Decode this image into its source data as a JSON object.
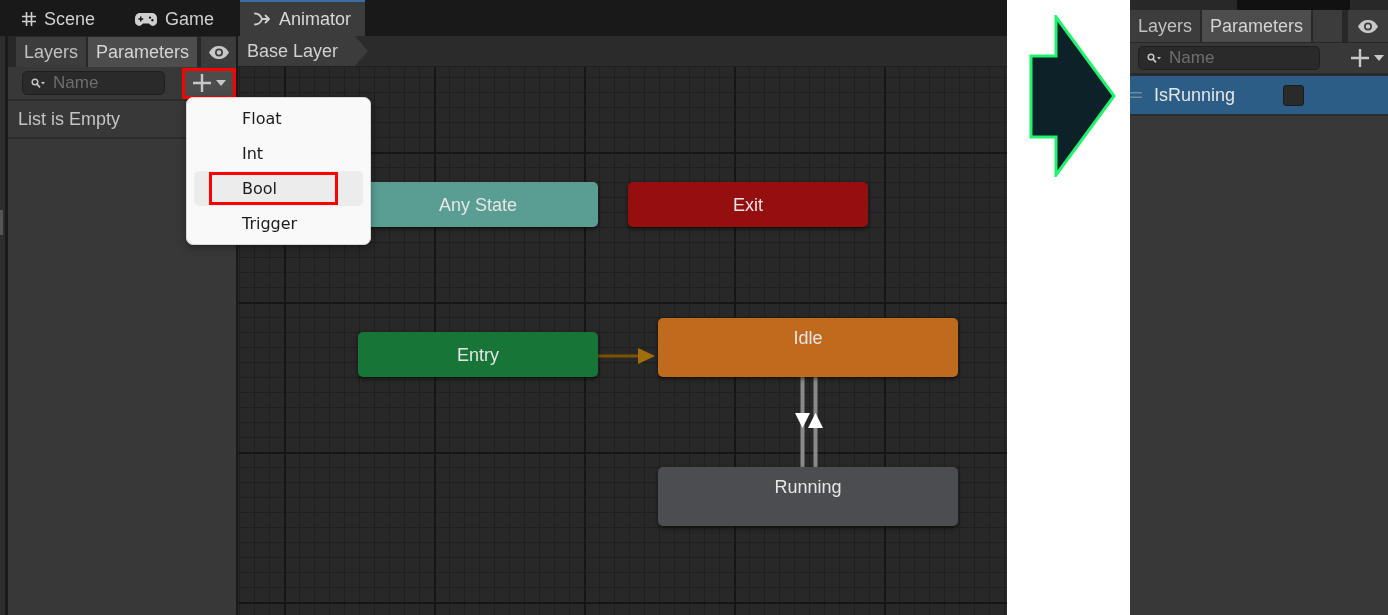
{
  "animator_window": {
    "editor_tabs": [
      {
        "label": "Scene",
        "kind": "scene",
        "selected": false
      },
      {
        "label": "Game",
        "kind": "game",
        "selected": false
      },
      {
        "label": "Animator",
        "kind": "animator",
        "selected": true
      }
    ],
    "panel_tabs": [
      {
        "label": "Layers",
        "selected": false
      },
      {
        "label": "Parameters",
        "selected": true
      }
    ],
    "search": {
      "placeholder": "Name"
    },
    "add_button": {
      "highlighted": true
    },
    "empty_list_text": "List is Empty",
    "breadcrumb": "Base Layer",
    "graph": {
      "states": [
        {
          "label": "Any State",
          "kind": "special",
          "color": "#5a9e93"
        },
        {
          "label": "Exit",
          "kind": "special",
          "color": "#960f0f"
        },
        {
          "label": "Entry",
          "kind": "special",
          "color": "#177538"
        },
        {
          "label": "Idle",
          "kind": "state",
          "color": "#c06a1e"
        },
        {
          "label": "Running",
          "kind": "state",
          "color": "#4b4d51"
        }
      ]
    },
    "add_menu": {
      "items": [
        {
          "label": "Float",
          "highlighted": false
        },
        {
          "label": "Int",
          "highlighted": false
        },
        {
          "label": "Bool",
          "highlighted": true
        },
        {
          "label": "Trigger",
          "highlighted": false
        }
      ]
    }
  },
  "parameters_panel": {
    "panel_tabs": [
      {
        "label": "Layers",
        "selected": false
      },
      {
        "label": "Parameters",
        "selected": true
      }
    ],
    "search": {
      "placeholder": "Name"
    },
    "add_button": {
      "highlighted": false
    },
    "parameters": [
      {
        "name": "IsRunning",
        "selected": true,
        "checked": false
      }
    ]
  }
}
